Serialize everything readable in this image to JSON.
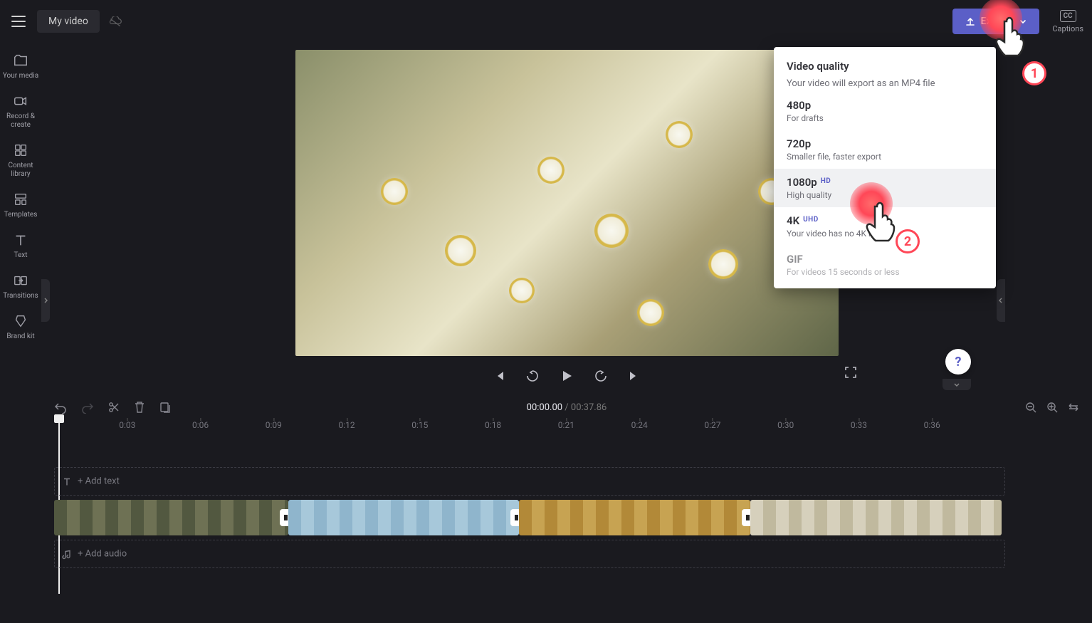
{
  "topbar": {
    "video_title": "My video",
    "export_label": "Export",
    "captions_label": "Captions",
    "cc_text": "CC"
  },
  "sidebar": {
    "items": [
      {
        "label": "Your media"
      },
      {
        "label": "Record & create"
      },
      {
        "label": "Content library"
      },
      {
        "label": "Templates"
      },
      {
        "label": "Text"
      },
      {
        "label": "Transitions"
      },
      {
        "label": "Brand kit"
      }
    ]
  },
  "export_dropdown": {
    "title": "Video quality",
    "subtitle": "Your video will export as an MP4 file",
    "options": [
      {
        "name": "480p",
        "desc": "For drafts",
        "badge": ""
      },
      {
        "name": "720p",
        "desc": "Smaller file, faster export",
        "badge": ""
      },
      {
        "name": "1080p",
        "desc": "High quality",
        "badge": "HD"
      },
      {
        "name": "4K",
        "desc": "Your video has no 4K media",
        "badge": "UHD"
      },
      {
        "name": "GIF",
        "desc": "For videos 15 seconds or less",
        "badge": ""
      }
    ]
  },
  "timeline": {
    "current_time": "00:00.00",
    "duration": "00:37.86",
    "ruler_labels": [
      "0:03",
      "0:06",
      "0:09",
      "0:12",
      "0:15",
      "0:18",
      "0:21",
      "0:24",
      "0:27",
      "0:30",
      "0:33",
      "0:36"
    ],
    "add_text_hint": "+ Add text",
    "add_audio_hint": "+ Add audio"
  },
  "click_markers": {
    "marker1_num": "1",
    "marker2_num": "2"
  },
  "help_char": "?"
}
